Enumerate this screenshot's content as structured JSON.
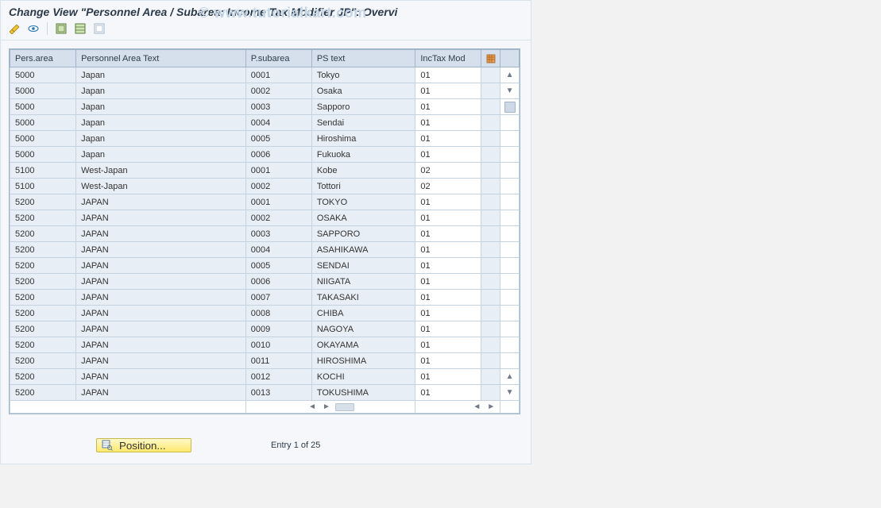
{
  "title": "Change View \"Personnel Area / Subarea: Income Tax Modifier JP\": Overvi",
  "watermark": "© www.tutorialkart.com",
  "toolbar": {
    "icons": [
      "change-display",
      "new-entries",
      "select-all",
      "deselect-all",
      "table-settings"
    ]
  },
  "table": {
    "headers": {
      "pers_area": "Pers.area",
      "pers_area_text": "Personnel Area Text",
      "p_subarea": "P.subarea",
      "ps_text": "PS text",
      "inctax_mod": "IncTax Mod"
    },
    "rows": [
      {
        "pa": "5000",
        "pat": "Japan",
        "ps": "0001",
        "pst": "Tokyo",
        "mod": "01"
      },
      {
        "pa": "5000",
        "pat": "Japan",
        "ps": "0002",
        "pst": "Osaka",
        "mod": "01"
      },
      {
        "pa": "5000",
        "pat": "Japan",
        "ps": "0003",
        "pst": "Sapporo",
        "mod": "01"
      },
      {
        "pa": "5000",
        "pat": "Japan",
        "ps": "0004",
        "pst": "Sendai",
        "mod": "01"
      },
      {
        "pa": "5000",
        "pat": "Japan",
        "ps": "0005",
        "pst": "Hiroshima",
        "mod": "01"
      },
      {
        "pa": "5000",
        "pat": "Japan",
        "ps": "0006",
        "pst": "Fukuoka",
        "mod": "01"
      },
      {
        "pa": "5100",
        "pat": "West-Japan",
        "ps": "0001",
        "pst": "Kobe",
        "mod": "02"
      },
      {
        "pa": "5100",
        "pat": "West-Japan",
        "ps": "0002",
        "pst": "Tottori",
        "mod": "02"
      },
      {
        "pa": "5200",
        "pat": "JAPAN",
        "ps": "0001",
        "pst": "TOKYO",
        "mod": "01"
      },
      {
        "pa": "5200",
        "pat": "JAPAN",
        "ps": "0002",
        "pst": "OSAKA",
        "mod": "01"
      },
      {
        "pa": "5200",
        "pat": "JAPAN",
        "ps": "0003",
        "pst": "SAPPORO",
        "mod": "01"
      },
      {
        "pa": "5200",
        "pat": "JAPAN",
        "ps": "0004",
        "pst": "ASAHIKAWA",
        "mod": "01"
      },
      {
        "pa": "5200",
        "pat": "JAPAN",
        "ps": "0005",
        "pst": "SENDAI",
        "mod": "01"
      },
      {
        "pa": "5200",
        "pat": "JAPAN",
        "ps": "0006",
        "pst": "NIIGATA",
        "mod": "01"
      },
      {
        "pa": "5200",
        "pat": "JAPAN",
        "ps": "0007",
        "pst": "TAKASAKI",
        "mod": "01"
      },
      {
        "pa": "5200",
        "pat": "JAPAN",
        "ps": "0008",
        "pst": "CHIBA",
        "mod": "01"
      },
      {
        "pa": "5200",
        "pat": "JAPAN",
        "ps": "0009",
        "pst": "NAGOYA",
        "mod": "01"
      },
      {
        "pa": "5200",
        "pat": "JAPAN",
        "ps": "0010",
        "pst": "OKAYAMA",
        "mod": "01"
      },
      {
        "pa": "5200",
        "pat": "JAPAN",
        "ps": "0011",
        "pst": "HIROSHIMA",
        "mod": "01"
      },
      {
        "pa": "5200",
        "pat": "JAPAN",
        "ps": "0012",
        "pst": "KOCHI",
        "mod": "01"
      },
      {
        "pa": "5200",
        "pat": "JAPAN",
        "ps": "0013",
        "pst": "TOKUSHIMA",
        "mod": "01"
      }
    ]
  },
  "footer": {
    "position_label": "Position...",
    "entry_status": "Entry 1 of 25"
  }
}
